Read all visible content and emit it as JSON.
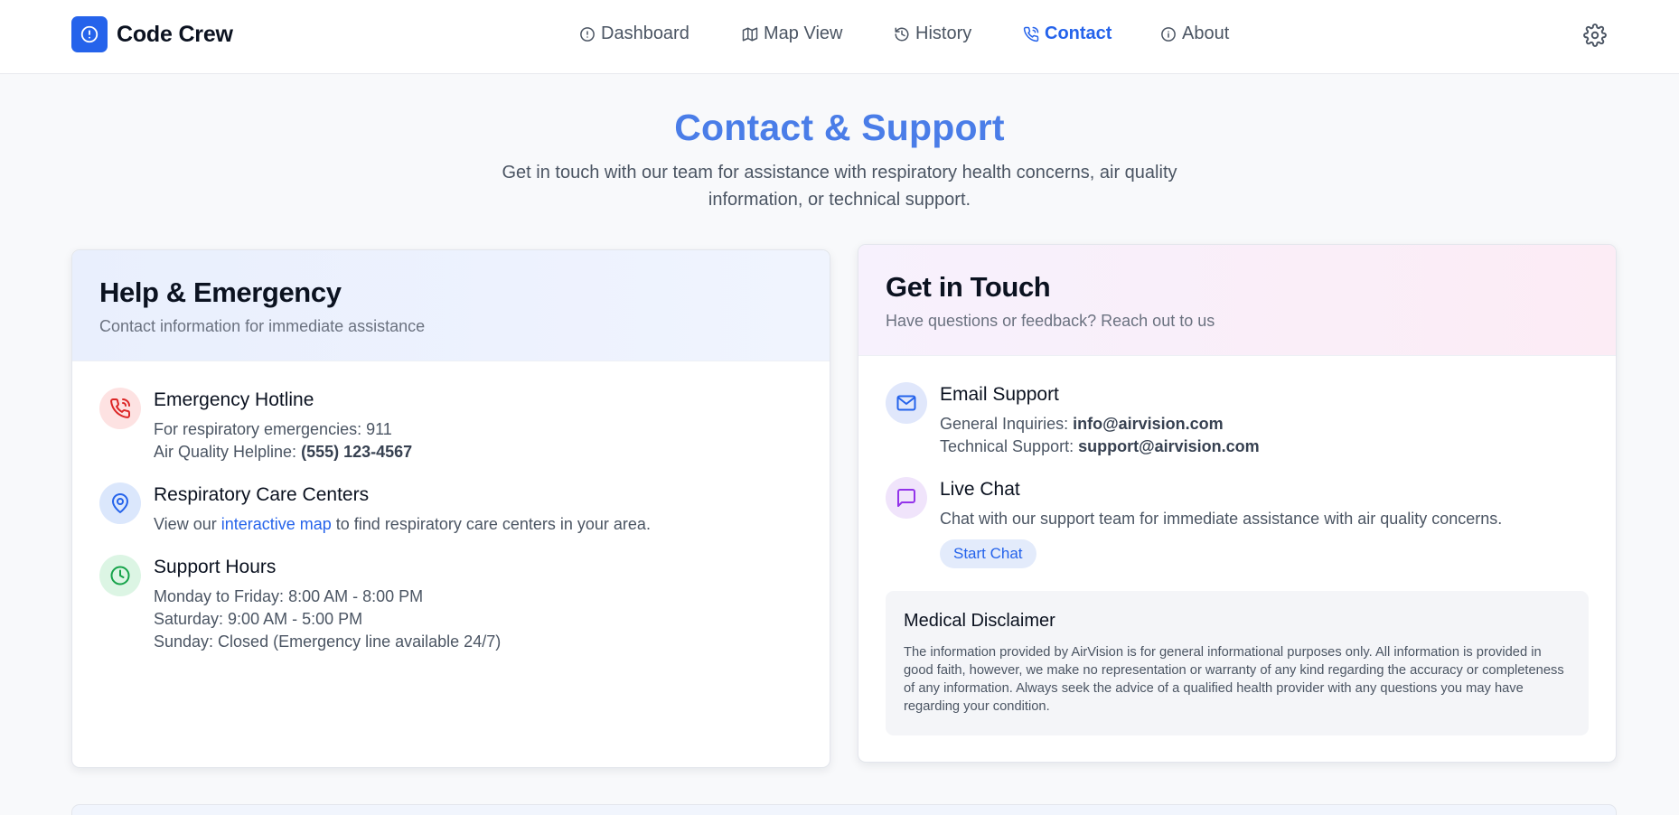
{
  "brand": {
    "name": "Code Crew",
    "logo_icon": "alert-circle-icon"
  },
  "nav": [
    {
      "label": "Dashboard",
      "icon": "alert-circle-icon",
      "active": false
    },
    {
      "label": "Map View",
      "icon": "map-icon",
      "active": false
    },
    {
      "label": "History",
      "icon": "history-icon",
      "active": false
    },
    {
      "label": "Contact",
      "icon": "phone-icon",
      "active": true
    },
    {
      "label": "About",
      "icon": "info-icon",
      "active": false
    }
  ],
  "settings_icon": "gear-icon",
  "hero": {
    "title": "Contact & Support",
    "subtitle": "Get in touch with our team for assistance with respiratory health concerns, air quality information, or technical support."
  },
  "help": {
    "title": "Help & Emergency",
    "subtitle": "Contact information for immediate assistance",
    "hotline": {
      "title": "Emergency Hotline",
      "line1_prefix": "For respiratory emergencies: ",
      "line1_value": "911",
      "line2_prefix": "Air Quality Helpline: ",
      "line2_value": "(555) 123-4567"
    },
    "centers": {
      "title": "Respiratory Care Centers",
      "text_before": "View our ",
      "link": "interactive map",
      "text_after": " to find respiratory care centers in your area."
    },
    "hours": {
      "title": "Support Hours",
      "lines": [
        "Monday to Friday: 8:00 AM - 8:00 PM",
        "Saturday: 9:00 AM - 5:00 PM",
        "Sunday: Closed (Emergency line available 24/7)"
      ]
    }
  },
  "touch": {
    "title": "Get in Touch",
    "subtitle": "Have questions or feedback? Reach out to us",
    "email": {
      "title": "Email Support",
      "general_prefix": "General Inquiries: ",
      "general_value": "info@airvision.com",
      "tech_prefix": "Technical Support: ",
      "tech_value": "support@airvision.com"
    },
    "chat": {
      "title": "Live Chat",
      "text": "Chat with our support team for immediate assistance with air quality concerns.",
      "button": "Start Chat"
    },
    "disclaimer": {
      "title": "Medical Disclaimer",
      "text": "The information provided by AirVision is for general informational purposes only. All information is provided in good faith, however, we make no representation or warranty of any kind regarding the accuracy or completeness of any information. Always seek the advice of a qualified health provider with any questions you may have regarding your condition."
    }
  },
  "colors": {
    "accent": "#2563eb",
    "hero_title": "#4a7de8",
    "hotline_icon_bg": "#fde2e2",
    "hotline_icon": "#dc2626",
    "location_icon_bg": "#dbe7fc",
    "hours_icon_bg": "#dcf5e4",
    "hours_icon": "#16a34a",
    "email_icon_bg": "#e0e7fb",
    "chat_icon_bg": "#f0e4fb",
    "chat_icon": "#9333ea"
  }
}
